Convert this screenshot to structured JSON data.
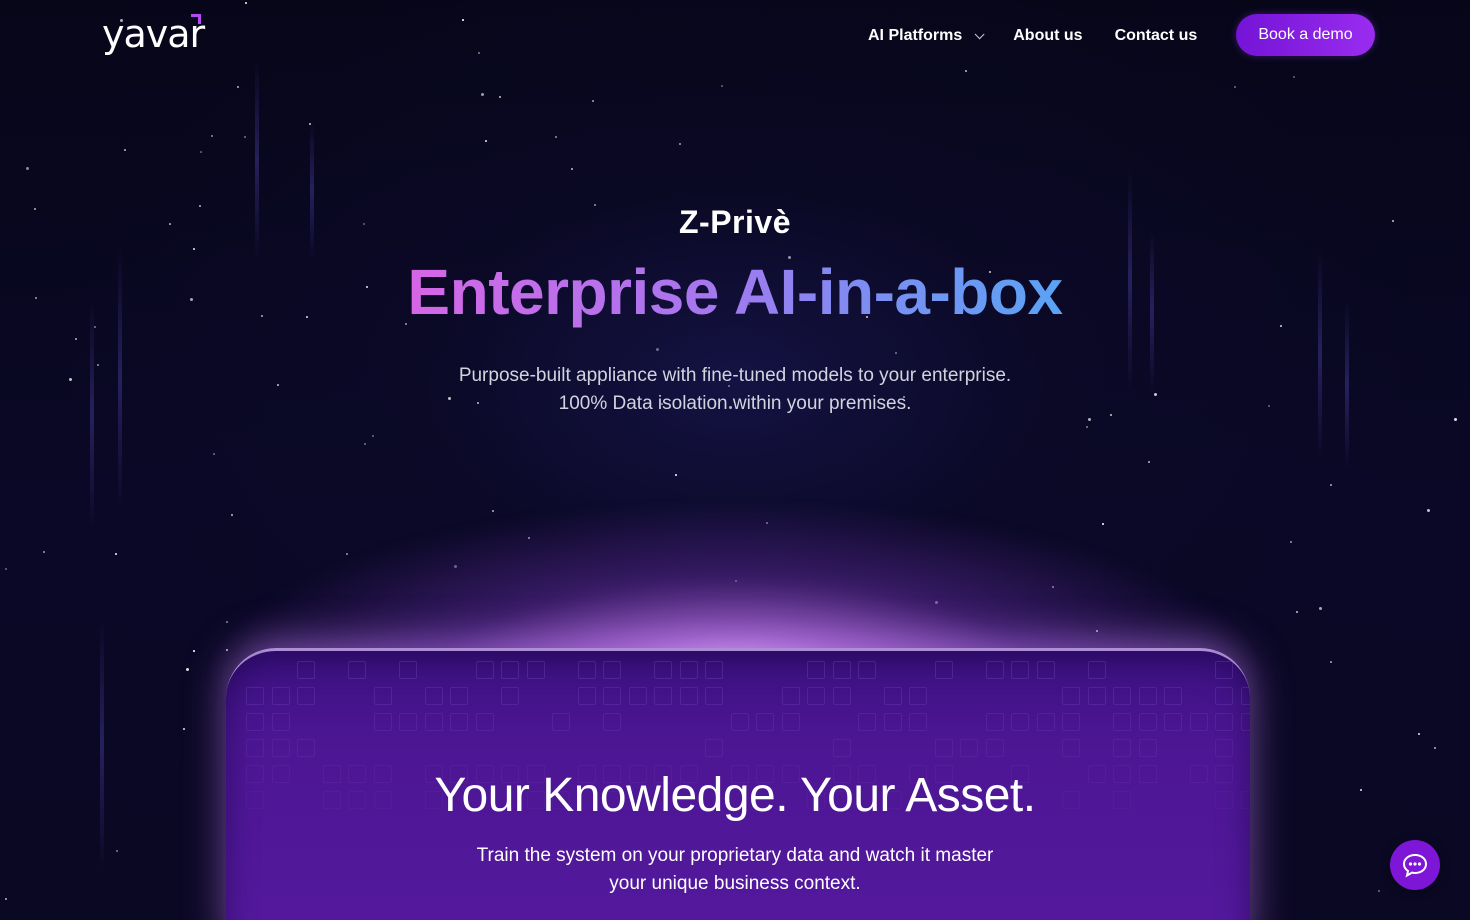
{
  "header": {
    "logo_text": "yavar",
    "nav": [
      {
        "label": "AI Platforms",
        "has_dropdown": true
      },
      {
        "label": "About us"
      },
      {
        "label": "Contact us"
      }
    ],
    "cta_label": "Book a demo"
  },
  "hero": {
    "eyebrow": "Z-Privè",
    "headline": "Enterprise AI-in-a-box",
    "sub_line1": "Purpose-built appliance with fine-tuned models to your enterprise.",
    "sub_line2": "100% Data isolation within your premises."
  },
  "box": {
    "title": "Your Knowledge. Your Asset.",
    "sub_line1": "Train the system on your proprietary data and watch it master",
    "sub_line2": "your unique business context."
  },
  "chat": {
    "icon": "chat-bubble-icon"
  },
  "colors": {
    "background": "#07061a",
    "accent": "#8a22e6",
    "headline_gradient_start": "#d666e6",
    "headline_gradient_end": "#5aa3f5",
    "box_purple": "#4c1693"
  }
}
